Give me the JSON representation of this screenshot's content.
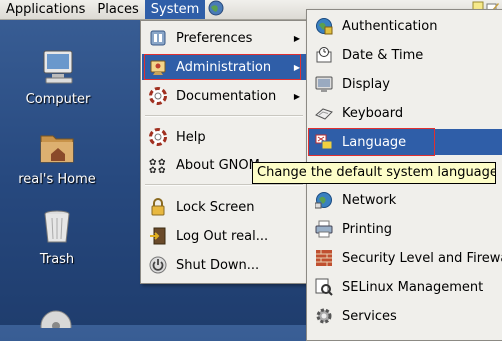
{
  "panel": {
    "menus": [
      "Applications",
      "Places",
      "System"
    ]
  },
  "desktop": {
    "icons": [
      {
        "label": "Computer",
        "icon": "computer-icon"
      },
      {
        "label": "real's Home",
        "icon": "home-folder-icon"
      },
      {
        "label": "Trash",
        "icon": "trash-icon"
      }
    ]
  },
  "system_menu": {
    "items": [
      {
        "label": "Preferences",
        "icon": "preferences-icon",
        "submenu": true
      },
      {
        "label": "Administration",
        "icon": "administration-icon",
        "submenu": true,
        "highlighted": true
      },
      {
        "label": "Documentation",
        "icon": "documentation-icon",
        "submenu": true
      },
      {
        "label": "Help",
        "icon": "help-icon"
      },
      {
        "label": "About GNOM",
        "icon": "about-gnome-icon"
      },
      {
        "label": "Lock Screen",
        "icon": "lock-icon"
      },
      {
        "label": "Log Out real...",
        "icon": "logout-icon"
      },
      {
        "label": "Shut Down...",
        "icon": "shutdown-icon"
      }
    ]
  },
  "admin_menu": {
    "items": [
      {
        "label": "Authentication",
        "icon": "authentication-icon"
      },
      {
        "label": "Date & Time",
        "icon": "date-time-icon"
      },
      {
        "label": "Display",
        "icon": "display-icon"
      },
      {
        "label": "Keyboard",
        "icon": "keyboard-icon"
      },
      {
        "label": "Language",
        "icon": "language-icon",
        "highlighted": true
      },
      {
        "label": "Network",
        "icon": "network-icon"
      },
      {
        "label": "Printing",
        "icon": "printer-icon"
      },
      {
        "label": "Security Level and Firewall",
        "icon": "security-icon"
      },
      {
        "label": "SELinux Management",
        "icon": "selinux-icon"
      },
      {
        "label": "Services",
        "icon": "services-icon"
      }
    ]
  },
  "tooltip": {
    "text": "Change the default system language"
  },
  "colors": {
    "highlight": "#2f5ea8",
    "desktop": "#2a4c84",
    "annotation": "#e03030",
    "tooltip_bg": "#fdfdc8"
  }
}
